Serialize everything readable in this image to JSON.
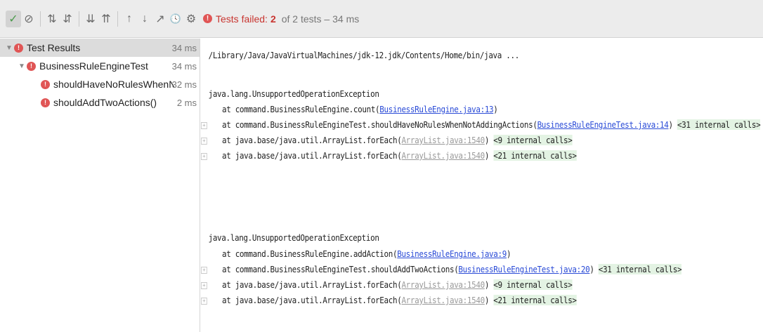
{
  "toolbar": {
    "buttons": [
      {
        "icon": "check-icon",
        "glyph": "✓"
      },
      {
        "icon": "stop-circle-icon",
        "glyph": "⊘"
      },
      {
        "icon": "sort-alpha-icon",
        "glyph": "⇅"
      },
      {
        "icon": "sort-duration-icon",
        "glyph": "⇵"
      },
      {
        "icon": "expand-all-icon",
        "glyph": "⇊"
      },
      {
        "icon": "collapse-all-icon",
        "glyph": "⇈"
      },
      {
        "icon": "up-arrow-icon",
        "glyph": "↑"
      },
      {
        "icon": "down-arrow-icon",
        "glyph": "↓"
      },
      {
        "icon": "export-icon",
        "glyph": "↗"
      },
      {
        "icon": "history-icon",
        "glyph": "🕓"
      },
      {
        "icon": "settings-icon",
        "glyph": "⚙"
      }
    ],
    "status": {
      "failed_label": "Tests failed:",
      "failed_count": "2",
      "rest": "of 2 tests – 34 ms"
    }
  },
  "tree": {
    "root": {
      "label": "Test Results",
      "time": "34 ms"
    },
    "suite": {
      "label": "BusinessRuleEngineTest",
      "time": "34 ms"
    },
    "tests": [
      {
        "label": "shouldHaveNoRulesWhenNotAc",
        "time": "32 ms"
      },
      {
        "label": "shouldAddTwoActions()",
        "time": "2 ms"
      }
    ]
  },
  "console": {
    "command": "/Library/Java/JavaVirtualMachines/jdk-12.jdk/Contents/Home/bin/java ...",
    "blocks": [
      {
        "exception": "java.lang.UnsupportedOperationException",
        "frames": [
          {
            "prefix": "at command.BusinessRuleEngine.count(",
            "link": "BusinessRuleEngine.java:13",
            "suffix": ")",
            "internal": ""
          },
          {
            "prefix": "at command.BusinessRuleEngineTest.shouldHaveNoRulesWhenNotAddingActions(",
            "link": "BusinessRuleEngineTest.java:14",
            "suffix": ")",
            "internal": "<31 internal calls>"
          },
          {
            "prefix": "at java.base/java.util.ArrayList.forEach(",
            "link": "ArrayList.java:1540",
            "suffix": ")",
            "internal": "<9 internal calls>"
          },
          {
            "prefix": "at java.base/java.util.ArrayList.forEach(",
            "link": "ArrayList.java:1540",
            "suffix": ")",
            "internal": "<21 internal calls>"
          }
        ]
      },
      {
        "exception": "java.lang.UnsupportedOperationException",
        "frames": [
          {
            "prefix": "at command.BusinessRuleEngine.addAction(",
            "link": "BusinessRuleEngine.java:9",
            "suffix": ")",
            "internal": ""
          },
          {
            "prefix": "at command.BusinessRuleEngineTest.shouldAddTwoActions(",
            "link": "BusinessRuleEngineTest.java:20",
            "suffix": ")",
            "internal": "<31 internal calls>"
          },
          {
            "prefix": "at java.base/java.util.ArrayList.forEach(",
            "link": "ArrayList.java:1540",
            "suffix": ")",
            "internal": "<9 internal calls>"
          },
          {
            "prefix": "at java.base/java.util.ArrayList.forEach(",
            "link": "ArrayList.java:1540",
            "suffix": ")",
            "internal": "<21 internal calls>"
          }
        ]
      }
    ]
  },
  "colors": {
    "fail": "#e05555",
    "link": "#2a4bd7",
    "internal_bg": "#e3f3e3"
  }
}
